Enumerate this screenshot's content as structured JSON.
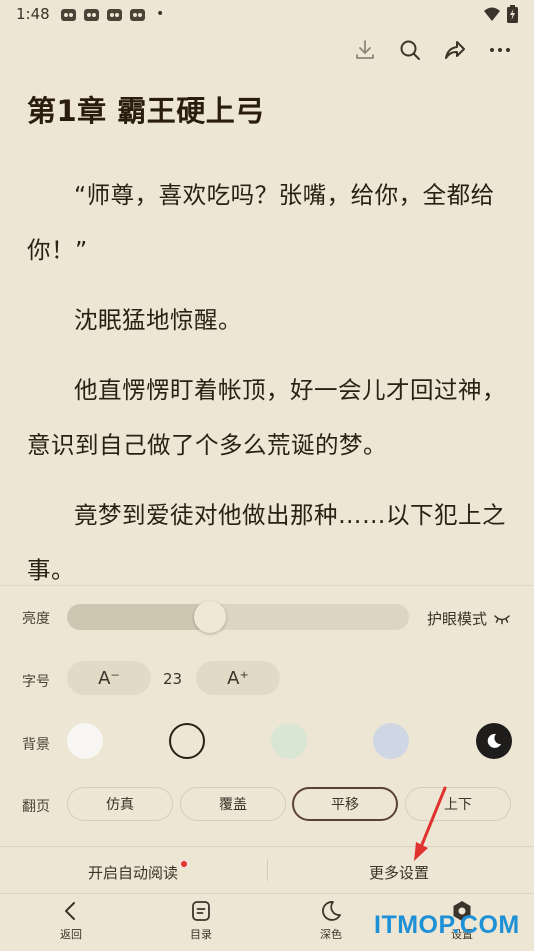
{
  "status_bar": {
    "time": "1:48",
    "more": "•"
  },
  "chapter": {
    "title": "第1章 霸王硬上弓",
    "paragraphs": [
      "“师尊，喜欢吃吗？张嘴，给你，全都给你！”",
      "沈眠猛地惊醒。",
      "他直愣愣盯着帐顶，好一会儿才回过神，意识到自己做了个多么荒诞的梦。",
      "竟梦到爱徒对他做出那种……以下犯上之事。"
    ]
  },
  "settings": {
    "brightness": {
      "label": "亮度",
      "level": 0.41,
      "eye_mode_label": "护眼模式"
    },
    "font_size": {
      "label": "字号",
      "decrease_label": "A⁻",
      "value": "23",
      "increase_label": "A⁺"
    },
    "background": {
      "label": "背景",
      "swatches": [
        {
          "color": "#f7f6f3",
          "selected": false
        },
        {
          "color": "#ede6d4",
          "selected": true
        },
        {
          "color": "#d9e6d3",
          "selected": false
        },
        {
          "color": "#cfd7e4",
          "selected": false
        },
        {
          "color": "#1f1d1b",
          "selected": false
        }
      ]
    },
    "page_turn": {
      "label": "翻页",
      "options": [
        "仿真",
        "覆盖",
        "平移",
        "上下"
      ],
      "selected": "平移"
    }
  },
  "bottom_options": {
    "auto_read": "开启自动阅读",
    "more_settings": "更多设置"
  },
  "nav": {
    "back": "返回",
    "toc": "目录",
    "dark": "深色",
    "settings": "设置"
  },
  "watermark": "ITMOP.COM",
  "colors": {
    "background": "#ede6d4",
    "accent": "#5a4330",
    "annotation": "#e0332f",
    "watermark": "#1e90d6"
  }
}
